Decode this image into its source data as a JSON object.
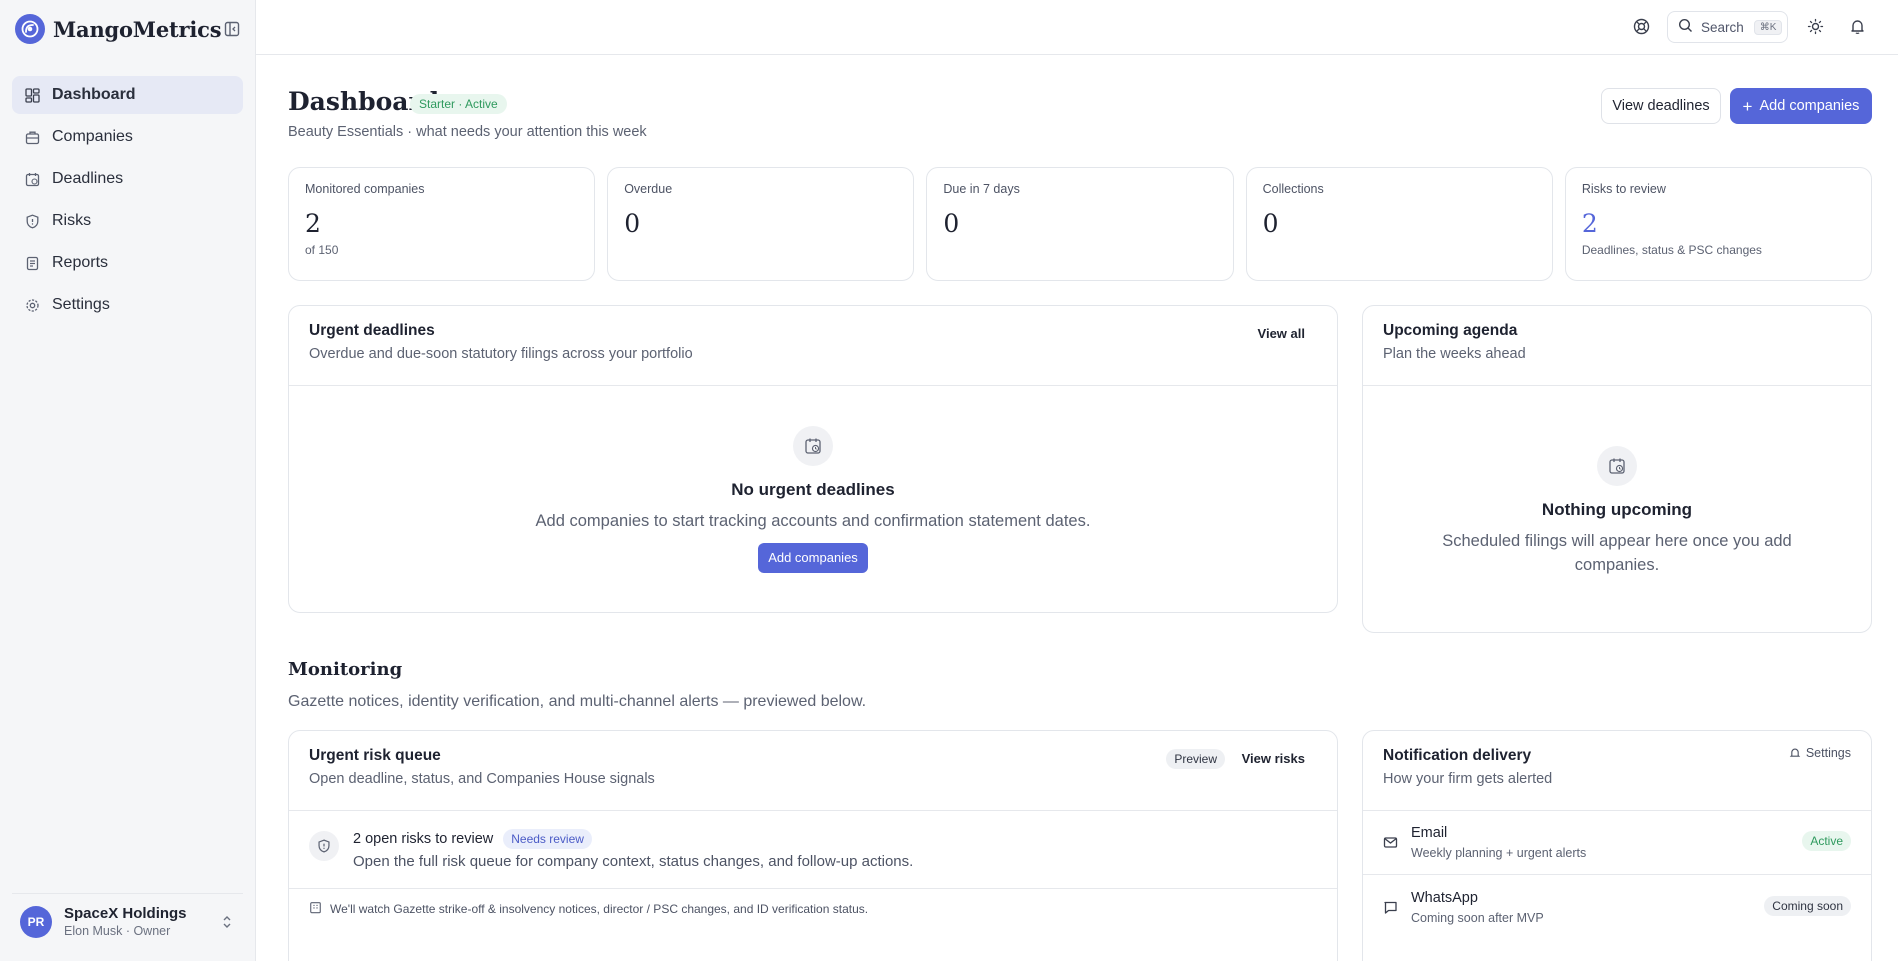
{
  "app": {
    "name": "MangoMetrics"
  },
  "sidebar": {
    "items": [
      {
        "label": "Dashboard",
        "icon": "dashboard-icon",
        "active": true
      },
      {
        "label": "Companies",
        "icon": "building-icon",
        "active": false
      },
      {
        "label": "Deadlines",
        "icon": "calendar-clock-icon",
        "active": false
      },
      {
        "label": "Risks",
        "icon": "shield-icon",
        "active": false
      },
      {
        "label": "Reports",
        "icon": "report-icon",
        "active": false
      },
      {
        "label": "Settings",
        "icon": "gear-icon",
        "active": false
      }
    ],
    "account": {
      "initials": "PR",
      "name": "SpaceX Holdings",
      "subtitle": "Elon Musk · Owner"
    }
  },
  "topbar": {
    "search_label": "Search",
    "search_shortcut": "⌘K"
  },
  "header": {
    "title": "Dashboard",
    "plan_badge": "Starter · Active",
    "subtitle": "Beauty Essentials · what needs your attention this week",
    "view_deadlines_label": "View deadlines",
    "add_companies_label": "Add companies"
  },
  "stats": [
    {
      "label": "Monitored companies",
      "value": "2",
      "sub": "of 150"
    },
    {
      "label": "Overdue",
      "value": "0",
      "sub": ""
    },
    {
      "label": "Due in 7 days",
      "value": "0",
      "sub": ""
    },
    {
      "label": "Collections",
      "value": "0",
      "sub": ""
    },
    {
      "label": "Risks to review",
      "value": "2",
      "sub": "Deadlines, status & PSC changes"
    }
  ],
  "urgent": {
    "title": "Urgent deadlines",
    "subtitle": "Overdue and due-soon statutory filings across your portfolio",
    "view_all": "View all",
    "empty_title": "No urgent deadlines",
    "empty_text": "Add companies to start tracking accounts and confirmation statement dates.",
    "button": "Add companies"
  },
  "agenda": {
    "title": "Upcoming agenda",
    "subtitle": "Plan the weeks ahead",
    "empty_title": "Nothing upcoming",
    "empty_text": "Scheduled filings will appear here once you add companies."
  },
  "monitoring": {
    "title": "Monitoring",
    "subtitle": "Gazette notices, identity verification, and multi-channel alerts — previewed below."
  },
  "risk_queue": {
    "title": "Urgent risk queue",
    "subtitle": "Open deadline, status, and Companies House signals",
    "preview": "Preview",
    "view_risks": "View risks",
    "row_title": "2 open risks to review",
    "row_badge": "Needs review",
    "row_desc": "Open the full risk queue for company context, status changes, and follow-up actions.",
    "footer": "We'll watch Gazette strike-off & insolvency notices, director / PSC changes, and ID verification status."
  },
  "notifications": {
    "title": "Notification delivery",
    "subtitle": "How your firm gets alerted",
    "settings": "Settings",
    "channels": [
      {
        "name": "Email",
        "desc": "Weekly planning + urgent alerts",
        "status": "Active"
      },
      {
        "name": "WhatsApp",
        "desc": "Coming soon after MVP",
        "status": "Coming soon"
      }
    ]
  },
  "colors": {
    "accent": "#5566d9",
    "success": "#2f9a5e",
    "sidebar_bg": "#f5f6f8"
  }
}
